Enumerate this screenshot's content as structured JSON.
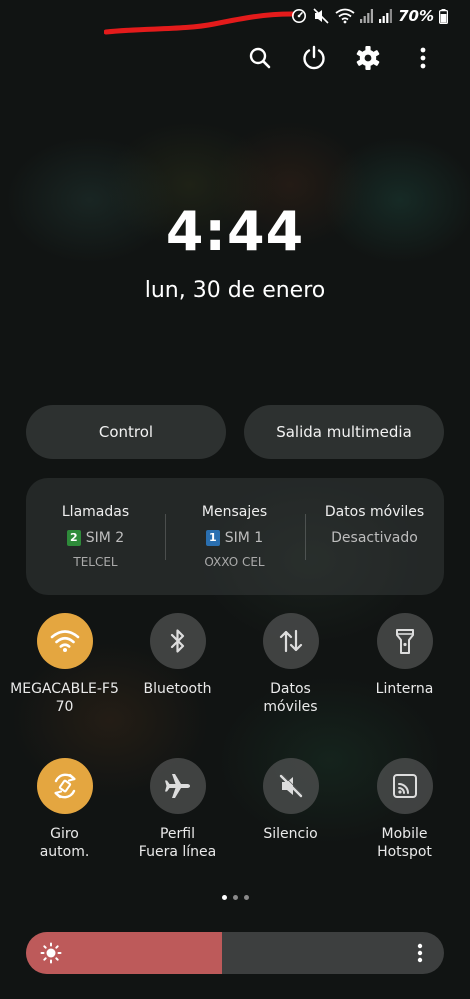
{
  "status_bar": {
    "battery_text": "70%",
    "icons": [
      "data-saver-icon",
      "mute-icon",
      "wifi-icon",
      "signal-sim2-icon",
      "signal-sim1-icon",
      "battery-icon"
    ]
  },
  "toolbar": {
    "icons": [
      "search-icon",
      "power-icon",
      "settings-gear-icon",
      "more-vert-icon"
    ]
  },
  "clock": {
    "time": "4:44",
    "date": "lun, 30 de enero"
  },
  "buttons": {
    "control": "Control",
    "media_output": "Salida multimedia"
  },
  "sim_panel": {
    "columns": [
      {
        "title": "Llamadas",
        "badge": "2",
        "badge_color": "#2e8b3a",
        "sim": "SIM 2",
        "carrier": "TELCEL"
      },
      {
        "title": "Mensajes",
        "badge": "1",
        "badge_color": "#2a6fb0",
        "sim": "SIM 1",
        "carrier": "OXXO CEL"
      },
      {
        "title": "Datos móviles",
        "status": "Desactivado"
      }
    ]
  },
  "tiles": [
    {
      "label": "MEGACABLE-F5\n70",
      "icon": "wifi-icon",
      "active": true
    },
    {
      "label": "Bluetooth",
      "icon": "bluetooth-icon",
      "active": false
    },
    {
      "label": "Datos\nmóviles",
      "icon": "mobile-data-icon",
      "active": false
    },
    {
      "label": "Linterna",
      "icon": "flashlight-icon",
      "active": false
    },
    {
      "label": "Giro\nautom.",
      "icon": "auto-rotate-icon",
      "active": true
    },
    {
      "label": "Perfil\nFuera línea",
      "icon": "airplane-icon",
      "active": false
    },
    {
      "label": "Silencio",
      "icon": "mute-icon",
      "active": false
    },
    {
      "label": "Mobile\nHotspot",
      "icon": "hotspot-icon",
      "active": false
    }
  ],
  "pagination": {
    "current": 1,
    "total": 3
  },
  "brightness": {
    "level": 0.47,
    "icon": "sun-icon"
  },
  "colors": {
    "accent": "#e4a640",
    "brightness_fill": "#bd5a5a",
    "annotation_scribble": "#e41b1b"
  }
}
